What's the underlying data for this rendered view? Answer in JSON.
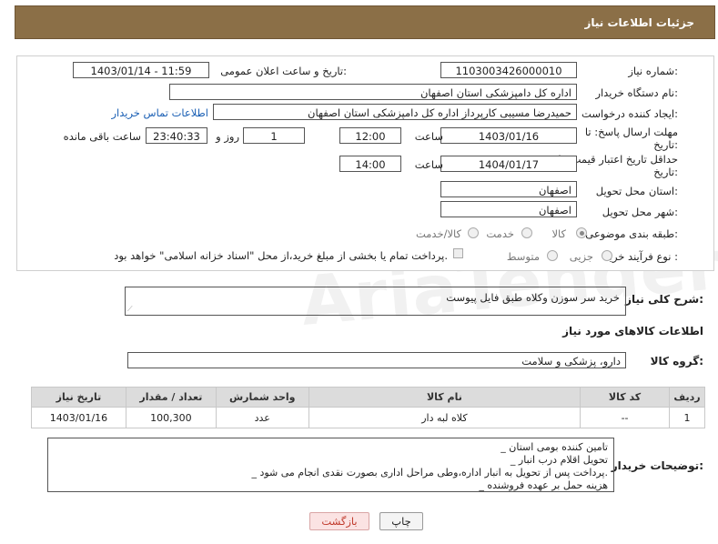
{
  "header": {
    "title": "جزئیات اطلاعات نیاز"
  },
  "form": {
    "need_number_label": "شماره نیاز:",
    "need_number": "1103003426000010",
    "announce_label": "تاریخ و ساعت اعلان عمومی:",
    "announce_value": "1403/01/14 - 11:59",
    "buyer_org_label": "نام دستگاه خریدار:",
    "buyer_org": "اداره کل دامپزشکی استان اصفهان",
    "creator_label": "ایجاد کننده درخواست:",
    "creator": "حمیدرضا مسیبی کارپرداز اداره کل دامپزشکی استان اصفهان",
    "contact_link": "اطلاعات تماس خریدار",
    "reply_deadline_label_1": "مهلت ارسال پاسخ: تا",
    "reply_deadline_label_2": "تاریخ:",
    "reply_date": "1403/01/16",
    "time_label": "ساعت",
    "reply_time": "12:00",
    "days": "1",
    "days_label": "روز و",
    "remaining": "23:40:33",
    "remaining_label": "ساعت باقی مانده",
    "price_deadline_label_1": "حداقل تاریخ اعتبار قیمت: تا",
    "price_deadline_label_2": "تاریخ:",
    "price_date": "1404/01/17",
    "price_time": "14:00",
    "province_label": "استان محل تحویل:",
    "province": "اصفهان",
    "city_label": "شهر محل تحویل:",
    "city": "اصفهان",
    "category_label": "طبقه بندی موضوعی:",
    "category_options": [
      "کالا",
      "خدمت",
      "کالا/خدمت"
    ],
    "process_label": "نوع فرآیند خرید :",
    "process_options": [
      "جزیی",
      "متوسط"
    ],
    "payment_note": "پرداخت تمام یا بخشی از مبلغ خرید،از محل \"اسناد خزانه اسلامی\" خواهد بود."
  },
  "summary": {
    "label": "شرح کلی نیاز:",
    "text": "خرید سر سوزن وکلاه طبق فایل پیوست"
  },
  "goods_section": {
    "title": "اطلاعات کالاهای مورد نیاز",
    "group_label": "گروه کالا:",
    "group_value": "دارو، پزشکی و سلامت"
  },
  "table": {
    "headers": [
      "ردیف",
      "کد کالا",
      "نام کالا",
      "واحد شمارش",
      "تعداد / مقدار",
      "تاریخ نیاز"
    ],
    "rows": [
      [
        "1",
        "--",
        "کلاه لبه دار",
        "عدد",
        "100,300",
        "1403/01/16"
      ]
    ]
  },
  "notes": {
    "label": "توضیحات خریدار:",
    "lines": [
      "_ تامین کننده بومی استان",
      "_ تحویل اقلام درب انبار",
      "_ پرداخت پس از تحویل به انبار اداره،وطی مراحل اداری بصورت نقدی انجام می شود.",
      "_ هزینه حمل بر عهده فروشنده"
    ]
  },
  "buttons": {
    "print": "چاپ",
    "back": "بازگشت"
  },
  "watermark": "AriaTender.net",
  "colors": {
    "header_bg": "#8b6f47",
    "link": "#1a5fb4",
    "back_btn_bg": "#fbe3e3",
    "back_btn_text": "#c0392b"
  }
}
